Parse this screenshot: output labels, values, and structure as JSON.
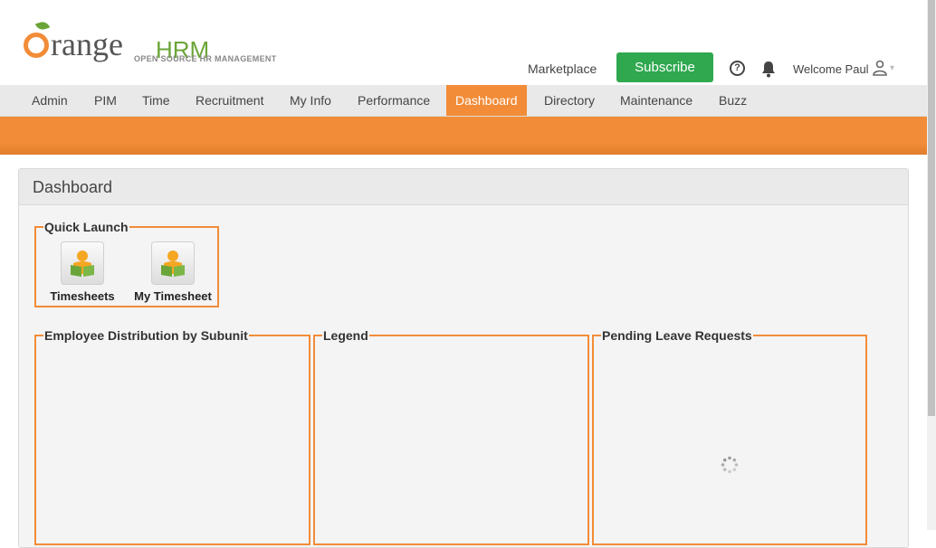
{
  "brand": {
    "logo_rest": "range",
    "logo_hrm": "HRM",
    "tagline": "OPEN SOURCE HR MANAGEMENT",
    "orange": "#f28c38",
    "green": "#6ba539"
  },
  "header": {
    "marketplace": "Marketplace",
    "subscribe": "Subscribe",
    "subscribe_color": "#2fa84f",
    "help_icon": "?",
    "bell_icon": "bell-icon",
    "welcome": "Welcome Paul",
    "user_icon": "user-icon",
    "caret": "▾"
  },
  "nav": {
    "items": [
      {
        "label": "Admin"
      },
      {
        "label": "PIM"
      },
      {
        "label": "Time"
      },
      {
        "label": "Recruitment"
      },
      {
        "label": "My Info"
      },
      {
        "label": "Performance"
      },
      {
        "label": "Dashboard",
        "active": true
      },
      {
        "label": "Directory"
      },
      {
        "label": "Maintenance"
      },
      {
        "label": "Buzz"
      }
    ]
  },
  "dashboard": {
    "title": "Dashboard",
    "quick_launch": {
      "title": "Quick Launch",
      "items": [
        {
          "label": "Timesheets",
          "icon": "timesheet-icon"
        },
        {
          "label": "My Timesheet",
          "icon": "timesheet-icon"
        }
      ]
    },
    "widgets": {
      "employee_distribution": "Employee Distribution by Subunit",
      "legend": "Legend",
      "pending_leave": "Pending Leave Requests"
    }
  }
}
